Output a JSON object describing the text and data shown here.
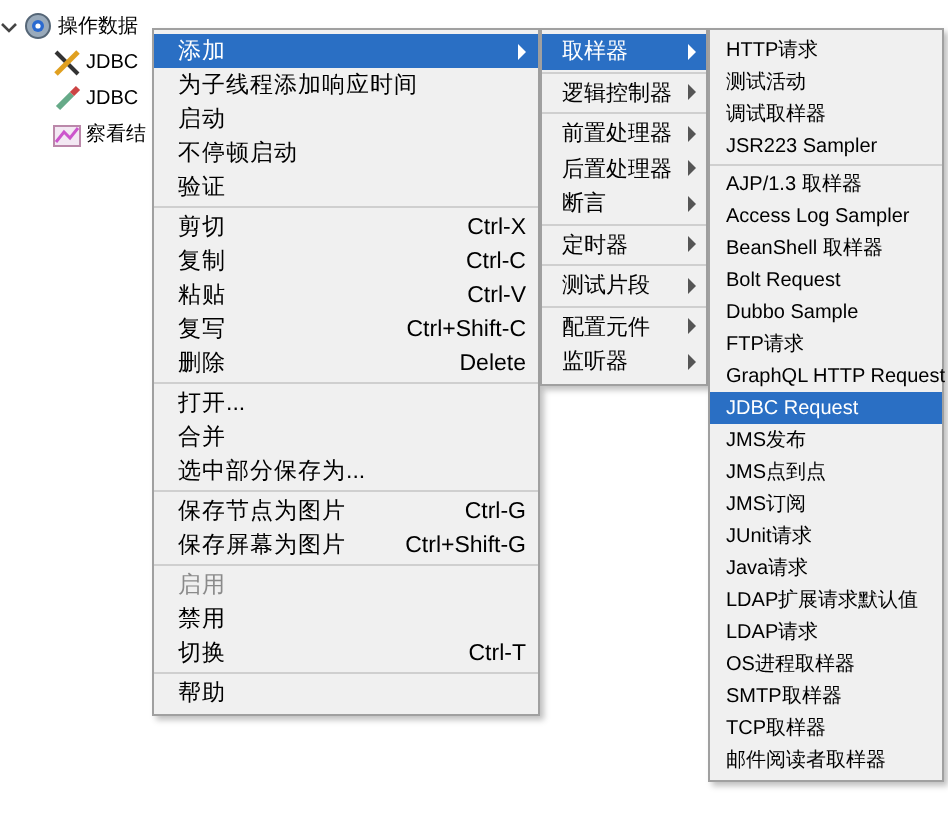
{
  "tree": [
    {
      "label": "操作数据",
      "expanded": true,
      "children": [
        {
          "label": "JDBC"
        },
        {
          "label": "JDBC"
        },
        {
          "label": "察看结"
        }
      ]
    }
  ],
  "menus": [
    {
      "items": [
        {
          "kind": "item",
          "label": "添加",
          "submenu": true,
          "selected": true,
          "disabled": false
        },
        {
          "kind": "item",
          "label": "为子线程添加响应时间",
          "selected": false,
          "disabled": false
        },
        {
          "kind": "item",
          "label": "启动",
          "selected": false,
          "disabled": false
        },
        {
          "kind": "item",
          "label": "不停顿启动",
          "selected": false,
          "disabled": false
        },
        {
          "kind": "item",
          "label": "验证",
          "selected": false,
          "disabled": false
        },
        {
          "kind": "separator"
        },
        {
          "kind": "item",
          "label": "剪切",
          "shortcut": "Ctrl-X",
          "selected": false,
          "disabled": false
        },
        {
          "kind": "item",
          "label": "复制",
          "shortcut": "Ctrl-C",
          "selected": false,
          "disabled": false
        },
        {
          "kind": "item",
          "label": "粘贴",
          "shortcut": "Ctrl-V",
          "selected": false,
          "disabled": false
        },
        {
          "kind": "item",
          "label": "复写",
          "shortcut": "Ctrl+Shift-C",
          "selected": false,
          "disabled": false
        },
        {
          "kind": "item",
          "label": "删除",
          "shortcut": "Delete",
          "selected": false,
          "disabled": false
        },
        {
          "kind": "separator"
        },
        {
          "kind": "item",
          "label": "打开...",
          "selected": false,
          "disabled": false
        },
        {
          "kind": "item",
          "label": "合并",
          "selected": false,
          "disabled": false
        },
        {
          "kind": "item",
          "label": "选中部分保存为...",
          "selected": false,
          "disabled": false
        },
        {
          "kind": "separator"
        },
        {
          "kind": "item",
          "label": "保存节点为图片",
          "shortcut": "Ctrl-G",
          "selected": false,
          "disabled": false
        },
        {
          "kind": "item",
          "label": "保存屏幕为图片",
          "shortcut": "Ctrl+Shift-G",
          "selected": false,
          "disabled": false
        },
        {
          "kind": "separator"
        },
        {
          "kind": "item",
          "label": "启用",
          "selected": false,
          "disabled": true
        },
        {
          "kind": "item",
          "label": "禁用",
          "selected": false,
          "disabled": false
        },
        {
          "kind": "item",
          "label": "切换",
          "shortcut": "Ctrl-T",
          "selected": false,
          "disabled": false
        },
        {
          "kind": "separator"
        },
        {
          "kind": "item",
          "label": "帮助",
          "selected": false,
          "disabled": false
        }
      ]
    },
    {
      "items": [
        {
          "kind": "item",
          "label": "取样器",
          "submenu": true,
          "selected": true,
          "disabled": false
        },
        {
          "kind": "separator"
        },
        {
          "kind": "item",
          "label": "逻辑控制器",
          "submenu": true,
          "selected": false,
          "disabled": false
        },
        {
          "kind": "separator"
        },
        {
          "kind": "item",
          "label": "前置处理器",
          "submenu": true,
          "selected": false,
          "disabled": false
        },
        {
          "kind": "item",
          "label": "后置处理器",
          "submenu": true,
          "selected": false,
          "disabled": false
        },
        {
          "kind": "item",
          "label": "断言",
          "submenu": true,
          "selected": false,
          "disabled": false
        },
        {
          "kind": "separator"
        },
        {
          "kind": "item",
          "label": "定时器",
          "submenu": true,
          "selected": false,
          "disabled": false
        },
        {
          "kind": "separator"
        },
        {
          "kind": "item",
          "label": "测试片段",
          "submenu": true,
          "selected": false,
          "disabled": false
        },
        {
          "kind": "separator"
        },
        {
          "kind": "item",
          "label": "配置元件",
          "submenu": true,
          "selected": false,
          "disabled": false
        },
        {
          "kind": "item",
          "label": "监听器",
          "submenu": true,
          "selected": false,
          "disabled": false
        }
      ]
    },
    {
      "items": [
        {
          "kind": "item",
          "label": "HTTP请求",
          "selected": false,
          "disabled": false
        },
        {
          "kind": "item",
          "label": "测试活动",
          "selected": false,
          "disabled": false
        },
        {
          "kind": "item",
          "label": "调试取样器",
          "selected": false,
          "disabled": false
        },
        {
          "kind": "item",
          "label": "JSR223 Sampler",
          "selected": false,
          "disabled": false
        },
        {
          "kind": "separator"
        },
        {
          "kind": "item",
          "label": "AJP/1.3 取样器",
          "selected": false,
          "disabled": false
        },
        {
          "kind": "item",
          "label": "Access Log Sampler",
          "selected": false,
          "disabled": false
        },
        {
          "kind": "item",
          "label": "BeanShell 取样器",
          "selected": false,
          "disabled": false
        },
        {
          "kind": "item",
          "label": "Bolt Request",
          "selected": false,
          "disabled": false
        },
        {
          "kind": "item",
          "label": "Dubbo Sample",
          "selected": false,
          "disabled": false
        },
        {
          "kind": "item",
          "label": "FTP请求",
          "selected": false,
          "disabled": false
        },
        {
          "kind": "item",
          "label": "GraphQL HTTP Request",
          "selected": false,
          "disabled": false
        },
        {
          "kind": "item",
          "label": "JDBC Request",
          "selected": true,
          "disabled": false
        },
        {
          "kind": "item",
          "label": "JMS发布",
          "selected": false,
          "disabled": false
        },
        {
          "kind": "item",
          "label": "JMS点到点",
          "selected": false,
          "disabled": false
        },
        {
          "kind": "item",
          "label": "JMS订阅",
          "selected": false,
          "disabled": false
        },
        {
          "kind": "item",
          "label": "JUnit请求",
          "selected": false,
          "disabled": false
        },
        {
          "kind": "item",
          "label": "Java请求",
          "selected": false,
          "disabled": false
        },
        {
          "kind": "item",
          "label": "LDAP扩展请求默认值",
          "selected": false,
          "disabled": false
        },
        {
          "kind": "item",
          "label": "LDAP请求",
          "selected": false,
          "disabled": false
        },
        {
          "kind": "item",
          "label": "OS进程取样器",
          "selected": false,
          "disabled": false
        },
        {
          "kind": "item",
          "label": "SMTP取样器",
          "selected": false,
          "disabled": false
        },
        {
          "kind": "item",
          "label": "TCP取样器",
          "selected": false,
          "disabled": false
        },
        {
          "kind": "item",
          "label": "邮件阅读者取样器",
          "selected": false,
          "disabled": false
        }
      ]
    }
  ]
}
